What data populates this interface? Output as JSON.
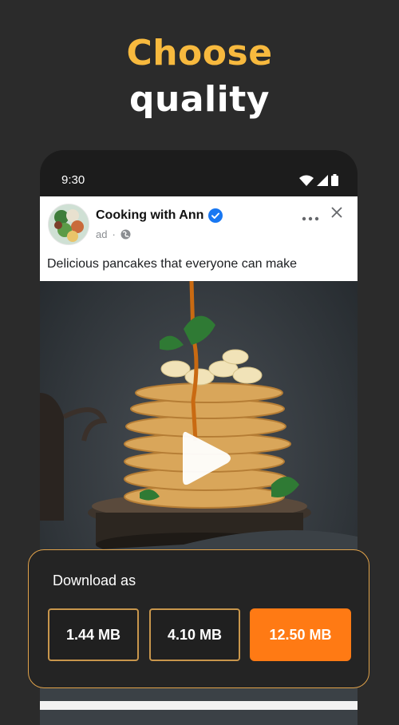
{
  "headline": {
    "line1": "Choose",
    "line2": "quality"
  },
  "status_bar": {
    "time": "9:30",
    "icons": [
      "wifi-icon",
      "signal-icon",
      "battery-icon"
    ]
  },
  "post": {
    "page_name": "Cooking with Ann",
    "verified": true,
    "meta_label": "ad",
    "meta_separator": "·",
    "caption": "Delicious pancakes that everyone can make",
    "more_icon": "more-horizontal-icon",
    "close_icon": "close-icon"
  },
  "download_sheet": {
    "title": "Download as",
    "options": [
      {
        "label": "1.44 MB",
        "selected": false
      },
      {
        "label": "4.10 MB",
        "selected": false
      },
      {
        "label": "12.50 MB",
        "selected": true
      }
    ]
  },
  "colors": {
    "accent_yellow": "#f7b93e",
    "accent_orange": "#ff7a14",
    "border_gold": "#c8964c",
    "background": "#2b2b2b",
    "verified_blue": "#1877f2"
  }
}
